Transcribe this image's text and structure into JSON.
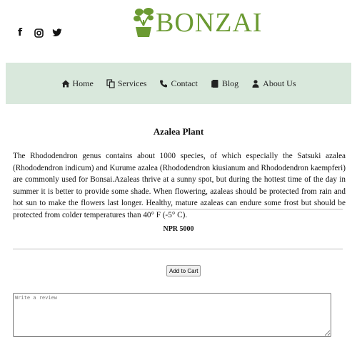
{
  "social": {
    "facebook_glyph": "f",
    "icons": [
      "facebook-icon",
      "instagram-icon",
      "twitter-icon"
    ]
  },
  "logo": {
    "text": "BONZAI",
    "color": "#6b9a32"
  },
  "nav": {
    "background": "#d9e8dc",
    "items": [
      {
        "label": "Home",
        "icon": "home-icon"
      },
      {
        "label": "Services",
        "icon": "copy-icon"
      },
      {
        "label": "Contact",
        "icon": "phone-icon"
      },
      {
        "label": "Blog",
        "icon": "tablet-icon"
      },
      {
        "label": "About Us",
        "icon": "user-icon"
      }
    ]
  },
  "product": {
    "title": "Azalea Plant",
    "description": "The Rhododendron genus contains about 1000 species, of which especially the Satsuki azalea (Rhododendron indicum) and Kurume azalea (Rhododendron kiusianum and Rhododendron kaempferi) are commonly used for Bonsai.Azaleas thrive at a sunny spot, but during the hottest time of the day in summer it is better to provide some shade. When flowering, azaleas should be protected from rain and hot sun to make the flowers last longer. Healthy, mature azaleas can endure some frost but should be protected from colder temperatures than 40° F (-5° C).",
    "price": "NPR 5000",
    "add_to_cart_label": "Add to Cart"
  },
  "review": {
    "placeholder": "Write a review",
    "value": ""
  }
}
